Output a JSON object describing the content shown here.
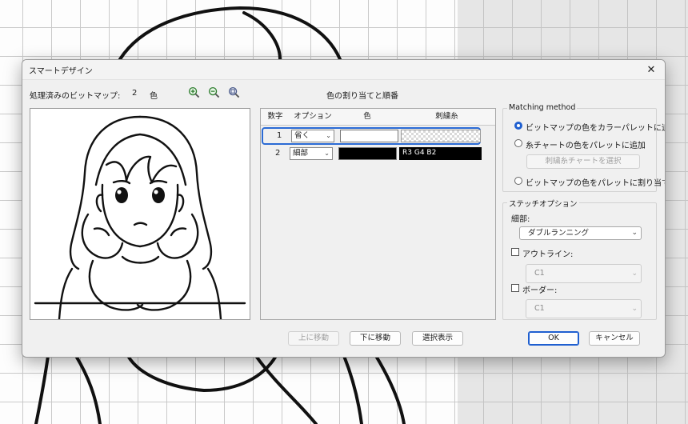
{
  "dialog": {
    "title": "スマートデザイン",
    "close_glyph": "✕"
  },
  "bitmap": {
    "label": "処理済みのビットマップ:",
    "count": "2",
    "unit": "色"
  },
  "table": {
    "title": "色の割り当てと順番",
    "headers": [
      "数字",
      "オプション",
      "色",
      "刺繍糸"
    ],
    "rows": [
      {
        "num": "1",
        "option": "省く",
        "color": "#ffffff",
        "thread": ""
      },
      {
        "num": "2",
        "option": "細部",
        "color": "#000000",
        "thread": "R3 G4 B2"
      }
    ]
  },
  "matching": {
    "title": "Matching method",
    "options": [
      {
        "label": "ビットマップの色をカラーパレットに追加",
        "checked": true
      },
      {
        "label": "糸チャートの色をパレットに追加",
        "checked": false
      },
      {
        "label": "ビットマップの色をパレットに割り当てる",
        "checked": false
      }
    ],
    "select_chart_button": "刺繍糸チャートを選択"
  },
  "stitch": {
    "title": "ステッチオプション",
    "detail_label": "細部:",
    "detail_value": "ダブルランニング",
    "outline_label": "アウトライン:",
    "outline_value": "C1",
    "border_label": "ボーダー:",
    "border_value": "C1"
  },
  "buttons": {
    "move_up": "上に移動",
    "move_down": "下に移動",
    "show_selection": "選択表示",
    "ok": "OK",
    "cancel": "キャンセル"
  },
  "icons": {
    "zoom_in": "zoom-in-icon",
    "zoom_out": "zoom-out-icon",
    "zoom_fit": "zoom-fit-icon"
  },
  "colors": {
    "accent": "#1f5fd0",
    "dialog_bg": "#f0f0f0"
  }
}
